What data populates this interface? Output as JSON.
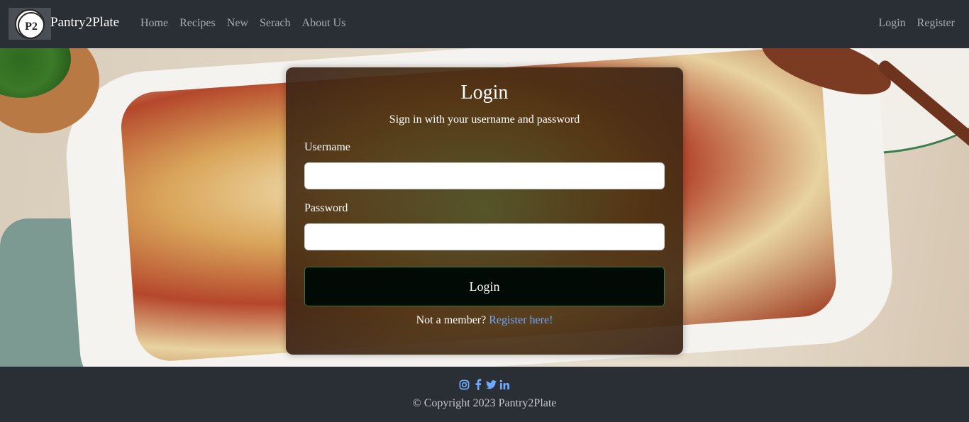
{
  "navbar": {
    "brand": "Pantry2Plate",
    "links": [
      "Home",
      "Recipes",
      "New",
      "Serach",
      "About Us"
    ],
    "right_links": [
      "Login",
      "Register"
    ]
  },
  "login_card": {
    "title": "Login",
    "subtitle": "Sign in with your username and password",
    "username_label": "Username",
    "username_value": "",
    "password_label": "Password",
    "password_value": "",
    "button_label": "Login",
    "member_text": "Not a member?",
    "register_link": "Register here!"
  },
  "footer": {
    "socials": [
      "instagram-icon",
      "facebook-icon",
      "twitter-icon",
      "linkedin-icon"
    ],
    "copyright": "© Copyright 2023 Pantry2Plate"
  },
  "colors": {
    "navbar": "#2a2f35",
    "link": "#6ea8fe",
    "button": "#020a05",
    "button_border": "#2c7a3f"
  }
}
